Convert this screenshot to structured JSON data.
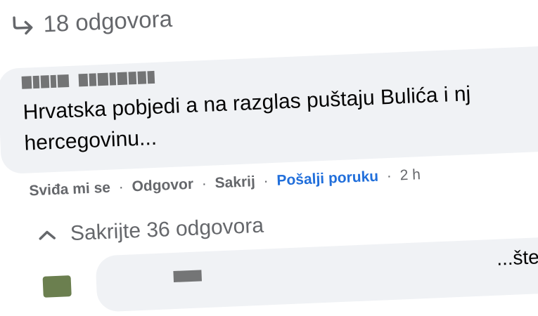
{
  "thread": {
    "replies_count_label": "18 odgovora",
    "comment": {
      "text": "Hrvatska pobjedi a na razglas puštaju Bulića i nj hercegovinu..."
    },
    "actions": {
      "like": "Sviđa mi se",
      "reply": "Odgovor",
      "hide": "Sakrij",
      "send_message": "Pošalji poruku",
      "time": "2 h",
      "separator": "·"
    },
    "hide_replies_label": "Sakrijte 36 odgovora",
    "next_comment_fragment": "...šte"
  },
  "colors": {
    "bubble": "#f0f2f5",
    "secondary_text": "#65676b",
    "link_blue": "#216fdb"
  },
  "icons": [
    "reply-arrow-icon",
    "chevron-up-icon"
  ]
}
